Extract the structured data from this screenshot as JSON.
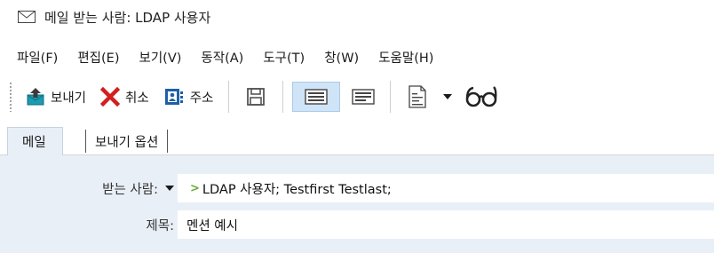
{
  "window": {
    "title": "메일 받는 사람: LDAP 사용자",
    "icon": "envelope-icon"
  },
  "menu": {
    "items": [
      {
        "label": "파일(F)"
      },
      {
        "label": "편집(E)"
      },
      {
        "label": "보기(V)"
      },
      {
        "label": "동작(A)"
      },
      {
        "label": "도구(T)"
      },
      {
        "label": "창(W)"
      },
      {
        "label": "도움말(H)"
      }
    ]
  },
  "toolbar": {
    "send_label": "보내기",
    "cancel_label": "취소",
    "address_label": "주소"
  },
  "tabs": {
    "mail": "메일",
    "send_options": "보내기 옵션"
  },
  "form": {
    "to_label": "받는 사람:",
    "to_value": "LDAP 사용자;  Testfirst Testlast;",
    "subject_label": "제목:",
    "subject_value": "멘션 예시"
  },
  "colors": {
    "form_background": "#e9eff6",
    "cancel_red": "#d21f1f",
    "send_teal": "#1a9bb0",
    "address_blue": "#1f5fa8",
    "recipient_chevron": "#6aaa3a",
    "toggle_active": "#cfe4f7"
  }
}
